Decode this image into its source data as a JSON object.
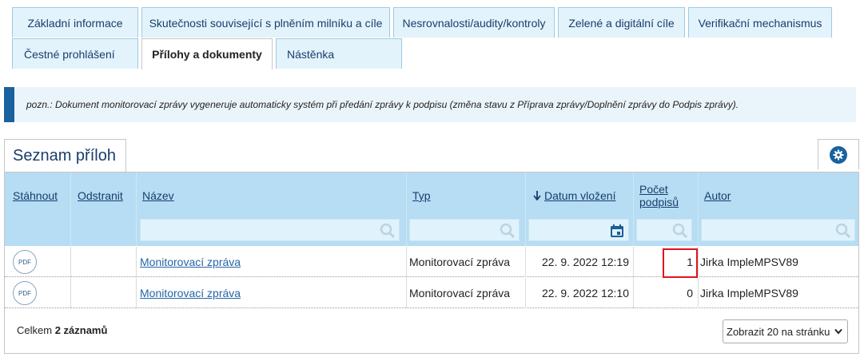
{
  "tabs": [
    {
      "label": "Základní informace",
      "active": false
    },
    {
      "label": "Skutečnosti související s plněním milníku a cíle",
      "active": false
    },
    {
      "label": "Nesrovnalosti/audity/kontroly",
      "active": false
    },
    {
      "label": "Zelené a digitální cíle",
      "active": false
    },
    {
      "label": "Verifikační mechanismus",
      "active": false
    },
    {
      "label": "Čestné prohlášení",
      "active": false
    },
    {
      "label": "Přílohy a dokumenty",
      "active": true
    },
    {
      "label": "Nástěnka",
      "active": false
    }
  ],
  "note": "pozn.: Dokument monitorovací zprávy vygeneruje automaticky systém při předání zprávy k podpisu (změna stavu z Příprava zprávy/Doplnění zprávy do Podpis zprávy).",
  "panel_title": "Seznam příloh",
  "columns": {
    "download": "Stáhnout",
    "remove": "Odstranit",
    "name": "Název",
    "type": "Typ",
    "date": "Datum vložení",
    "signatures_line1": "Počet",
    "signatures_line2": "podpisů",
    "author": "Autor"
  },
  "sort_icon": "arrow-down-icon",
  "rows": [
    {
      "download_icon": "PDF",
      "name": "Monitorovací zpráva",
      "type": "Monitorovací zpráva",
      "date": "22. 9. 2022 12:19",
      "signatures": "1",
      "author": "Jirka ImpleMPSV89"
    },
    {
      "download_icon": "PDF",
      "name": "Monitorovací zpráva",
      "type": "Monitorovací zpráva",
      "date": "22. 9. 2022 12:10",
      "signatures": "0",
      "author": "Jirka ImpleMPSV89"
    }
  ],
  "footer": {
    "total_prefix": "Celkem ",
    "total_count": "2 záznamů",
    "page_size": "Zobrazit 20 na stránku"
  },
  "colors": {
    "accent": "#19619f",
    "header_bg": "#b6ddf3",
    "highlight": "#e0141b"
  }
}
